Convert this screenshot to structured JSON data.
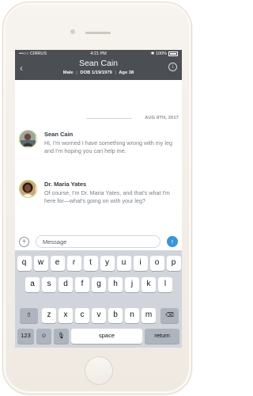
{
  "status_bar": {
    "carrier": "•••○○ CIRRUS",
    "time": "4:21 PM",
    "battery": "100%"
  },
  "header": {
    "title": "Sean Cain",
    "gender": "Male",
    "dob": "DOB 1/19/1979",
    "age": "Age 38",
    "separator": "|",
    "back_icon": "chevron-left-icon",
    "info_icon": "info-icon"
  },
  "thread": {
    "date": "AUG 8TH, 2017",
    "messages": [
      {
        "sender": "Sean Cain",
        "text": "Hi, I'm worried I have something wrong with my leg and I'm hoping you can help me."
      },
      {
        "sender": "Dr. Maria Yates",
        "text": "Of course, I'm Dr. Maria Yates, and that's what I'm here for—what's going on with your leg?"
      }
    ]
  },
  "composer": {
    "placeholder": "Message",
    "add_icon": "plus-circle-icon",
    "send_icon": "arrow-up-icon"
  },
  "keyboard": {
    "row1": [
      "q",
      "w",
      "e",
      "r",
      "t",
      "y",
      "u",
      "i",
      "o",
      "p"
    ],
    "row2": [
      "a",
      "s",
      "d",
      "f",
      "g",
      "h",
      "j",
      "k",
      "l"
    ],
    "row3": [
      "z",
      "x",
      "c",
      "v",
      "b",
      "n",
      "m"
    ],
    "numbers_label": "123",
    "space_label": "space",
    "return_label": "return"
  },
  "colors": {
    "header_bg": "#4b4f54",
    "accent": "#3a95d8",
    "avatar_ring": "#c9d37a"
  }
}
